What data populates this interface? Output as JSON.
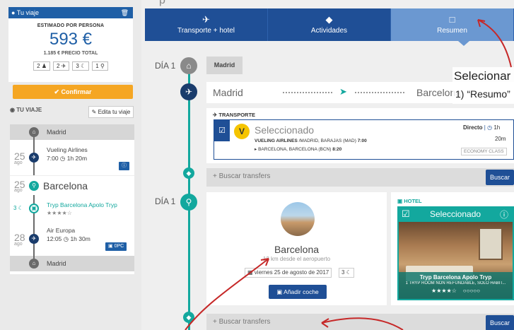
{
  "sidebar": {
    "trip_bar": {
      "label": "Tu viaje",
      "icon": "map-pin-icon",
      "trash_icon": "trash-icon"
    },
    "price": {
      "estimate_label": "ESTIMADO POR PERSONA",
      "amount": "593 €",
      "total_label": "1.185 € PRECIO TOTAL",
      "pax": [
        "2",
        "2",
        "3",
        "1"
      ]
    },
    "confirm_label": "Confirmar",
    "trip_section_label": "TU VIAJE",
    "edit_label": "Edita tu viaje",
    "itinerary": {
      "start_city": "Madrid",
      "end_city": "Madrid",
      "outbound": {
        "day": "25",
        "month": "ago",
        "airline": "Vueling Airlines",
        "time": "7:00",
        "duration": "1h 20m"
      },
      "city": {
        "day": "25",
        "month": "ago",
        "name": "Barcelona",
        "nights": "3",
        "hotel": "Tryp Barcelona Apolo Tryp"
      },
      "return": {
        "day": "28",
        "month": "ago",
        "airline": "Air Europa",
        "time": "12:05",
        "duration": "1h 30m",
        "badge": "0PC"
      }
    }
  },
  "header": {
    "cropped_caption": "p",
    "tabs": [
      {
        "label": "Transporte + hotel",
        "icon": "plane-hotel-icon"
      },
      {
        "label": "Actividades",
        "icon": "ticket-icon"
      },
      {
        "label": "Resumen",
        "icon": "document-icon"
      }
    ]
  },
  "main": {
    "day1_label": "DÍA 1",
    "day1b_label": "DÍA 1",
    "origin_city_tag": "Madrid",
    "route": {
      "from": "Madrid",
      "to": "Barcelona"
    },
    "transport": {
      "section_label": "TRANSPORTE",
      "selected_label": "Seleccionado",
      "airline": "VUELING AIRLINES",
      "dep": "/MADRID, BARAJAS (MAD)",
      "dep_time": "7:00",
      "arr": "BARCELONA, BARCELONA (BCN)",
      "arr_time": "8:20",
      "direct_label": "Directo",
      "duration_h": "1h",
      "duration_m": "20m",
      "class_label": "ECONOMY CLASS"
    },
    "transfer_label": "+ Buscar transfers",
    "transfer_button": "Buscar",
    "transfer2_label": "+ Buscar transfers",
    "transfer2_button": "Buscar",
    "city_card": {
      "name": "Barcelona",
      "subtitle": "12 km desde el aeropuerto",
      "date": "viernes 25 de agosto de 2017",
      "nights": "3",
      "add_car_label": "Añadir coche"
    },
    "hotel": {
      "section_label": "HOTEL",
      "selected_label": "Seleccionado",
      "name": "Tryp Barcelona Apolo Tryp",
      "rate": "1 TRYP ROOM NON REFUNDABLE, SOLO HABIT..."
    }
  },
  "annotation": {
    "line1": "Selecionar",
    "line2": "1) “Resumo”"
  },
  "colors": {
    "primary": "#1f4f96",
    "teal": "#13a89e",
    "orange": "#f5a623",
    "active_tab": "#6b98d1"
  }
}
